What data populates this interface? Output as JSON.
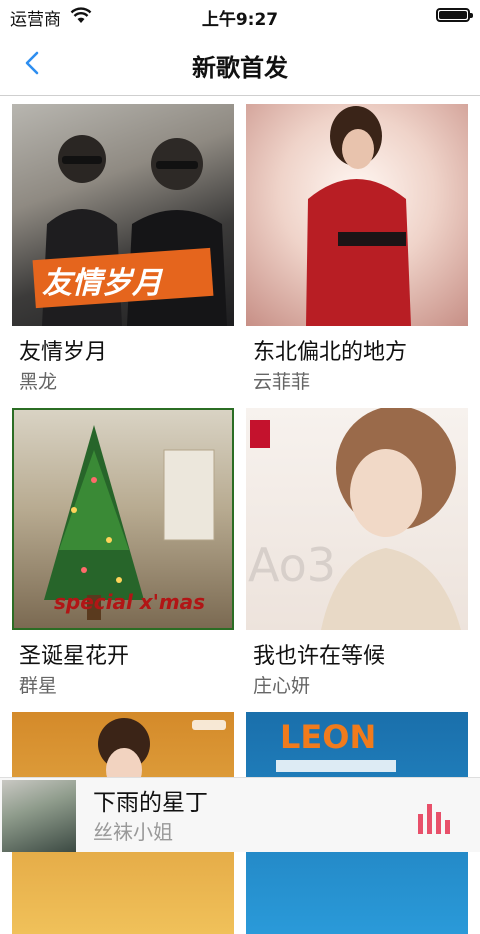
{
  "status_bar": {
    "carrier": "运营商",
    "time": "上午9:27"
  },
  "nav": {
    "title": "新歌首发",
    "back_icon": "chevron-left-icon",
    "accent": "#2e8ef0"
  },
  "songs": [
    {
      "title": "友情岁月",
      "artist": "黑龙",
      "cover_text": "友情岁月"
    },
    {
      "title": "东北偏北的地方",
      "artist": "云菲菲"
    },
    {
      "title": "圣诞星花开",
      "artist": "群星",
      "cover_text": "special x'mas"
    },
    {
      "title": "我也许在等候",
      "artist": "庄心妍",
      "cover_text": "Ao3"
    },
    {
      "title": "",
      "artist": ""
    },
    {
      "title": "",
      "artist": "",
      "cover_text": "LEON"
    }
  ],
  "now_playing": {
    "title": "下雨的星丁",
    "artist": "丝袜小姐",
    "accent": "#e8506a"
  }
}
